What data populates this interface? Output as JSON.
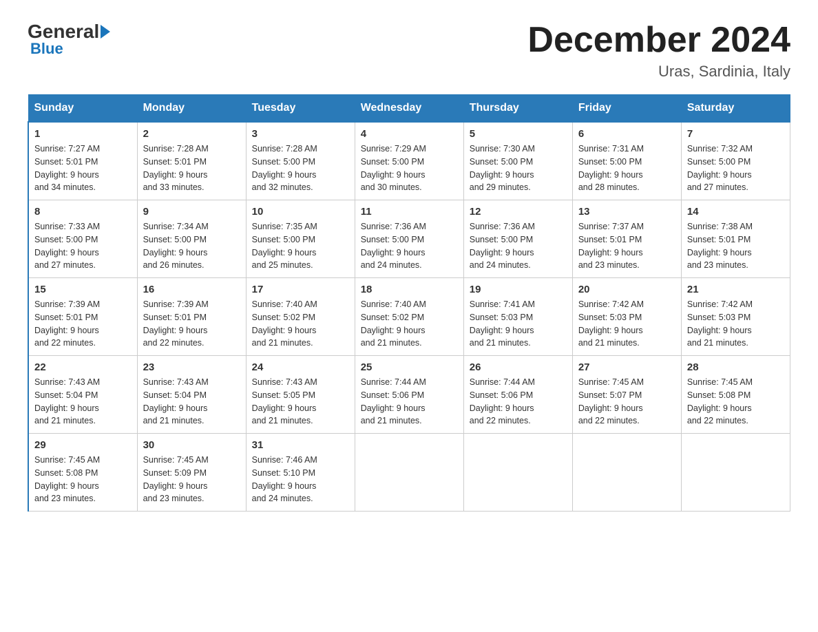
{
  "logo": {
    "general": "General",
    "blue": "Blue"
  },
  "title": {
    "month": "December 2024",
    "location": "Uras, Sardinia, Italy"
  },
  "weekdays": [
    "Sunday",
    "Monday",
    "Tuesday",
    "Wednesday",
    "Thursday",
    "Friday",
    "Saturday"
  ],
  "weeks": [
    [
      {
        "day": "1",
        "sunrise": "7:27 AM",
        "sunset": "5:01 PM",
        "daylight": "9 hours and 34 minutes."
      },
      {
        "day": "2",
        "sunrise": "7:28 AM",
        "sunset": "5:01 PM",
        "daylight": "9 hours and 33 minutes."
      },
      {
        "day": "3",
        "sunrise": "7:28 AM",
        "sunset": "5:00 PM",
        "daylight": "9 hours and 32 minutes."
      },
      {
        "day": "4",
        "sunrise": "7:29 AM",
        "sunset": "5:00 PM",
        "daylight": "9 hours and 30 minutes."
      },
      {
        "day": "5",
        "sunrise": "7:30 AM",
        "sunset": "5:00 PM",
        "daylight": "9 hours and 29 minutes."
      },
      {
        "day": "6",
        "sunrise": "7:31 AM",
        "sunset": "5:00 PM",
        "daylight": "9 hours and 28 minutes."
      },
      {
        "day": "7",
        "sunrise": "7:32 AM",
        "sunset": "5:00 PM",
        "daylight": "9 hours and 27 minutes."
      }
    ],
    [
      {
        "day": "8",
        "sunrise": "7:33 AM",
        "sunset": "5:00 PM",
        "daylight": "9 hours and 27 minutes."
      },
      {
        "day": "9",
        "sunrise": "7:34 AM",
        "sunset": "5:00 PM",
        "daylight": "9 hours and 26 minutes."
      },
      {
        "day": "10",
        "sunrise": "7:35 AM",
        "sunset": "5:00 PM",
        "daylight": "9 hours and 25 minutes."
      },
      {
        "day": "11",
        "sunrise": "7:36 AM",
        "sunset": "5:00 PM",
        "daylight": "9 hours and 24 minutes."
      },
      {
        "day": "12",
        "sunrise": "7:36 AM",
        "sunset": "5:00 PM",
        "daylight": "9 hours and 24 minutes."
      },
      {
        "day": "13",
        "sunrise": "7:37 AM",
        "sunset": "5:01 PM",
        "daylight": "9 hours and 23 minutes."
      },
      {
        "day": "14",
        "sunrise": "7:38 AM",
        "sunset": "5:01 PM",
        "daylight": "9 hours and 23 minutes."
      }
    ],
    [
      {
        "day": "15",
        "sunrise": "7:39 AM",
        "sunset": "5:01 PM",
        "daylight": "9 hours and 22 minutes."
      },
      {
        "day": "16",
        "sunrise": "7:39 AM",
        "sunset": "5:01 PM",
        "daylight": "9 hours and 22 minutes."
      },
      {
        "day": "17",
        "sunrise": "7:40 AM",
        "sunset": "5:02 PM",
        "daylight": "9 hours and 21 minutes."
      },
      {
        "day": "18",
        "sunrise": "7:40 AM",
        "sunset": "5:02 PM",
        "daylight": "9 hours and 21 minutes."
      },
      {
        "day": "19",
        "sunrise": "7:41 AM",
        "sunset": "5:03 PM",
        "daylight": "9 hours and 21 minutes."
      },
      {
        "day": "20",
        "sunrise": "7:42 AM",
        "sunset": "5:03 PM",
        "daylight": "9 hours and 21 minutes."
      },
      {
        "day": "21",
        "sunrise": "7:42 AM",
        "sunset": "5:03 PM",
        "daylight": "9 hours and 21 minutes."
      }
    ],
    [
      {
        "day": "22",
        "sunrise": "7:43 AM",
        "sunset": "5:04 PM",
        "daylight": "9 hours and 21 minutes."
      },
      {
        "day": "23",
        "sunrise": "7:43 AM",
        "sunset": "5:04 PM",
        "daylight": "9 hours and 21 minutes."
      },
      {
        "day": "24",
        "sunrise": "7:43 AM",
        "sunset": "5:05 PM",
        "daylight": "9 hours and 21 minutes."
      },
      {
        "day": "25",
        "sunrise": "7:44 AM",
        "sunset": "5:06 PM",
        "daylight": "9 hours and 21 minutes."
      },
      {
        "day": "26",
        "sunrise": "7:44 AM",
        "sunset": "5:06 PM",
        "daylight": "9 hours and 22 minutes."
      },
      {
        "day": "27",
        "sunrise": "7:45 AM",
        "sunset": "5:07 PM",
        "daylight": "9 hours and 22 minutes."
      },
      {
        "day": "28",
        "sunrise": "7:45 AM",
        "sunset": "5:08 PM",
        "daylight": "9 hours and 22 minutes."
      }
    ],
    [
      {
        "day": "29",
        "sunrise": "7:45 AM",
        "sunset": "5:08 PM",
        "daylight": "9 hours and 23 minutes."
      },
      {
        "day": "30",
        "sunrise": "7:45 AM",
        "sunset": "5:09 PM",
        "daylight": "9 hours and 23 minutes."
      },
      {
        "day": "31",
        "sunrise": "7:46 AM",
        "sunset": "5:10 PM",
        "daylight": "9 hours and 24 minutes."
      },
      null,
      null,
      null,
      null
    ]
  ],
  "labels": {
    "sunrise": "Sunrise:",
    "sunset": "Sunset:",
    "daylight": "Daylight:"
  }
}
